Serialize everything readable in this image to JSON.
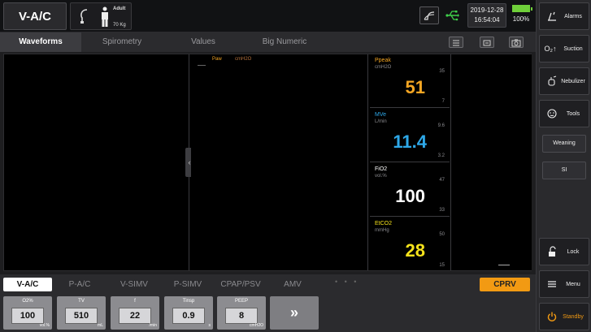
{
  "header": {
    "mode": "V-A/C",
    "patient_type": "Adult",
    "patient_weight": "70 Kg",
    "date": "2019-12-28",
    "time": "16:54:04",
    "battery_percent": "100%",
    "icons": [
      "tube-hook-icon",
      "person-icon",
      "loop-icon",
      "usb-icon",
      "battery-icon"
    ]
  },
  "tabs": {
    "items": [
      {
        "label": "Waveforms",
        "active": true
      },
      {
        "label": "Spirometry",
        "active": false
      },
      {
        "label": "Values",
        "active": false
      },
      {
        "label": "Big Numeric",
        "active": false
      }
    ],
    "tool_icons": [
      "list-icon",
      "freeze-icon",
      "camera-icon"
    ]
  },
  "waveform": {
    "label": "Paw",
    "unit": "cmH2O"
  },
  "numerics": [
    {
      "name": "Ppeak",
      "unit": "cmH2O",
      "value": "51",
      "high": "35",
      "low": "7",
      "color": "#f5a623"
    },
    {
      "name": "MVe",
      "unit": "L/min",
      "value": "11.4",
      "high": "9.6",
      "low": "3.2",
      "color": "#2ea8e8"
    },
    {
      "name": "FiO2",
      "unit": "vol.%",
      "value": "100",
      "high": "47",
      "low": "33",
      "color": "#ffffff"
    },
    {
      "name": "EtCO2",
      "unit": "mmHg",
      "value": "28",
      "high": "50",
      "low": "15",
      "color": "#f5e21b"
    }
  ],
  "modes": {
    "items": [
      "V-A/C",
      "P-A/C",
      "V-SIMV",
      "P-SIMV",
      "CPAP/PSV",
      "AMV"
    ],
    "active": "V-A/C",
    "dots": "• • •",
    "cprv": "CPRV"
  },
  "params": [
    {
      "name": "O2%",
      "value": "100",
      "unit": "vol.%"
    },
    {
      "name": "TV",
      "value": "510",
      "unit": "mL"
    },
    {
      "name": "f",
      "value": "22",
      "unit": "/min"
    },
    {
      "name": "Tinsp",
      "value": "0.9",
      "unit": "s"
    },
    {
      "name": "PEEP",
      "value": "8",
      "unit": "cmH2O"
    }
  ],
  "more_label": "»",
  "sidebar": {
    "alarms": "Alarms",
    "suction": "Suction",
    "suction_icon_text": "O₂↑",
    "nebulizer": "Nebulizer",
    "tools": "Tools",
    "weaning": "Weaning",
    "si": "SI",
    "lock": "Lock",
    "menu": "Menu",
    "standby": "Standby"
  },
  "colors": {
    "standby_icon": "#f29a13",
    "accent_orange": "#f29a13",
    "battery_green": "#6fcf3a",
    "usb_green": "#3fcf4a"
  }
}
